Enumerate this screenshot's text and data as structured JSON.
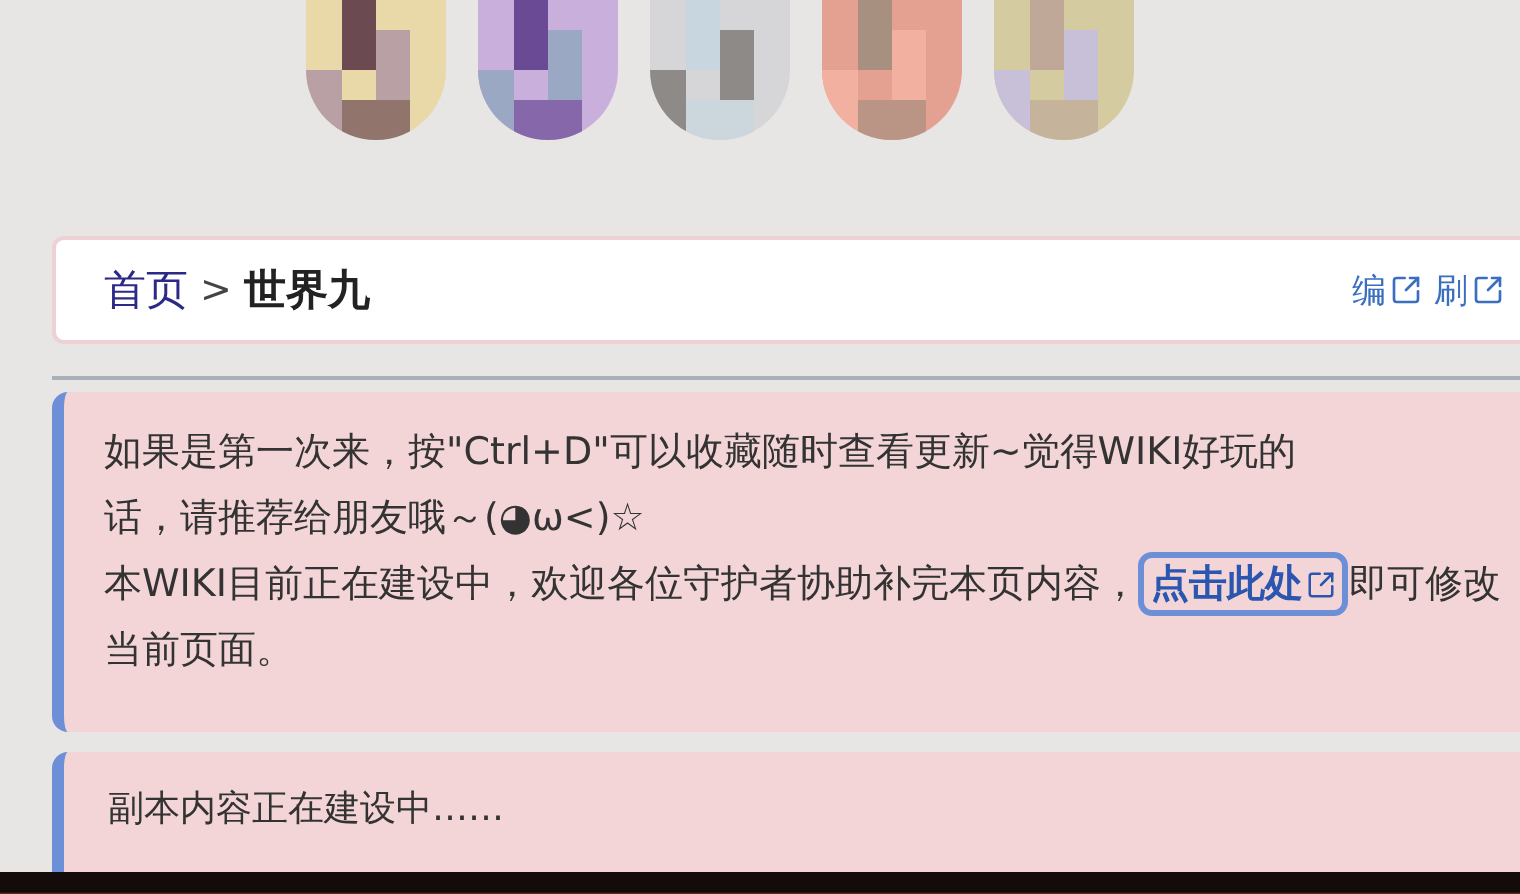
{
  "breadcrumb": {
    "home": "首页",
    "separator": ">",
    "current": "世界九",
    "actions": [
      "编",
      "刷"
    ]
  },
  "notice": {
    "lines": [
      "如果是第一次来，按\"Ctrl+D\"可以收藏随时查看更新~觉得WIKI好玩的",
      "话，请推荐给朋友哦～(◕ω<)☆"
    ],
    "text": "本WIKI目前正在建设中，欢迎各位守护者协助补完本页内容，",
    "link": "点击此处",
    "after": "即可修改当前页面。"
  },
  "section": {
    "text": "副本内容正在建设中……"
  }
}
